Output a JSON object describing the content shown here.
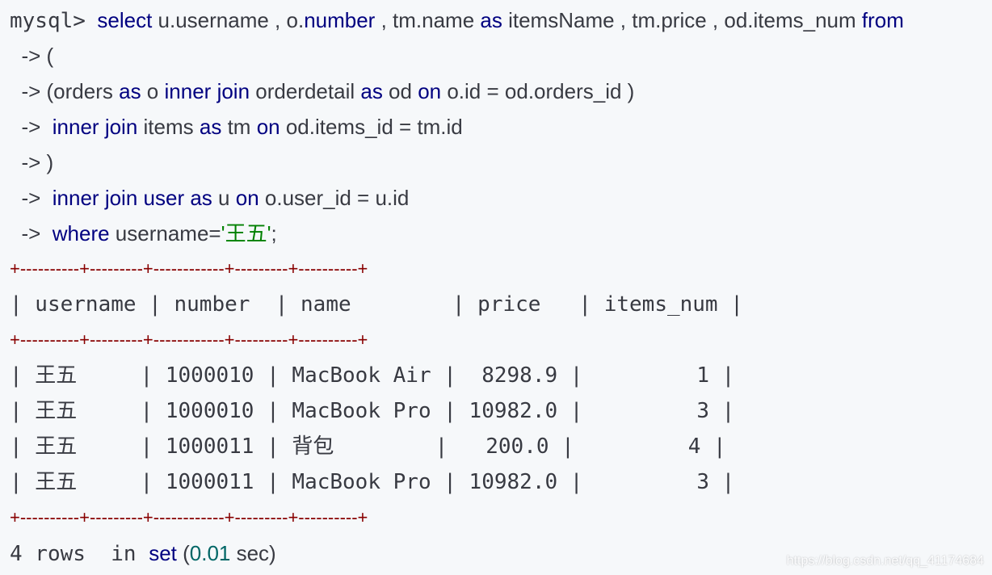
{
  "query": {
    "l1_prompt": "mysql>",
    "l1_select": "select",
    "l1_t1": " u.username , o.",
    "l1_number": "number",
    "l1_t2": " , tm.name ",
    "l1_as": "as",
    "l1_t3": " itemsName , tm.price , od.items_num ",
    "l1_from": "from",
    "cont": "->",
    "l2_t1": " (",
    "l3_t1": " (orders ",
    "l3_as1": "as",
    "l3_t2": " o ",
    "l3_inner": "inner",
    "l3_join": "join",
    "l3_t3": " orderdetail ",
    "l3_as2": "as",
    "l3_t4": " od ",
    "l3_on": "on",
    "l3_t5": " o.id = od.orders_id )",
    "l4_inner": "inner",
    "l4_join": "join",
    "l4_t1": " items ",
    "l4_as": "as",
    "l4_t2": " tm ",
    "l4_on": "on",
    "l4_t3": " od.items_id = tm.id",
    "l5_t1": " )",
    "l6_inner": "inner",
    "l6_join": "join",
    "l6_user": "user",
    "l6_as": "as",
    "l6_t1": " u ",
    "l6_on": "on",
    "l6_t2": " o.user_id = u.id",
    "l7_where": "where",
    "l7_t1": " username=",
    "l7_str": "'王五'",
    "l7_t2": ";"
  },
  "result": {
    "border": "+----------+---------+------------+---------+----------+",
    "header": "| username | number  | name        | price   | items_num |",
    "rows": [
      "| 王五     | 1000010 | MacBook Air |  8298.9 |         1 |",
      "| 王五     | 1000010 | MacBook Pro | 10982.0 |         3 |",
      "| 王五     | 1000011 | 背包        |   200.0 |         4 |",
      "| 王五     | 1000011 | MacBook Pro | 10982.0 |         3 |"
    ]
  },
  "footer": {
    "t1": "4 rows  in ",
    "set": "set",
    "t2": " (",
    "time": "0.01",
    "t3": " sec)"
  },
  "watermark": "https://blog.csdn.net/qq_41174684"
}
